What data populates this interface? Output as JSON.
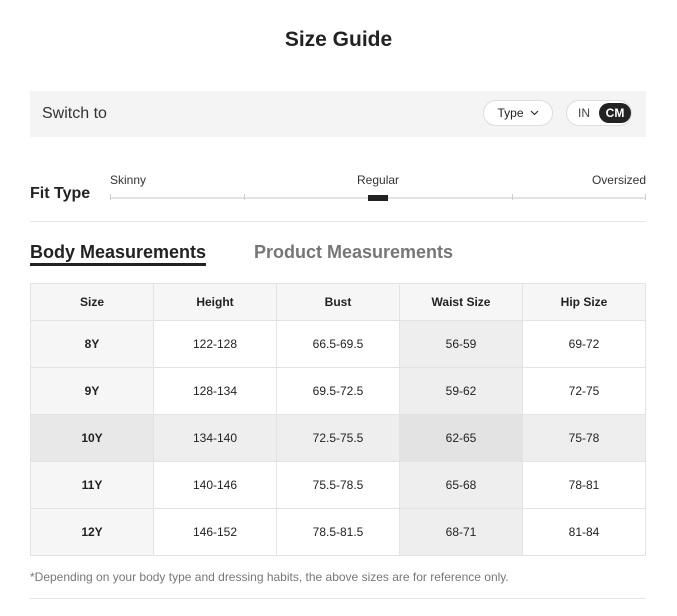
{
  "title": "Size Guide",
  "switch_bar": {
    "label": "Switch to",
    "type_button": "Type",
    "units": {
      "in": "IN",
      "cm": "CM",
      "selected": "CM"
    }
  },
  "fit_type": {
    "label": "Fit Type",
    "skinny": "Skinny",
    "regular": "Regular",
    "oversized": "Oversized",
    "selected": "Regular"
  },
  "tabs": [
    {
      "label": "Body Measurements",
      "active": true
    },
    {
      "label": "Product Measurements",
      "active": false
    }
  ],
  "table": {
    "headers": [
      "Size",
      "Height",
      "Bust",
      "Waist Size",
      "Hip Size"
    ],
    "rows": [
      [
        "8Y",
        "122-128",
        "66.5-69.5",
        "56-59",
        "69-72"
      ],
      [
        "9Y",
        "128-134",
        "69.5-72.5",
        "59-62",
        "72-75"
      ],
      [
        "10Y",
        "134-140",
        "72.5-75.5",
        "62-65",
        "75-78"
      ],
      [
        "11Y",
        "140-146",
        "75.5-78.5",
        "65-68",
        "78-81"
      ],
      [
        "12Y",
        "146-152",
        "78.5-81.5",
        "68-71",
        "81-84"
      ]
    ],
    "highlighted_row": "10Y",
    "highlighted_column": "Waist Size"
  },
  "note": "*Depending on your body type and dressing habits, the above sizes are for reference only."
}
